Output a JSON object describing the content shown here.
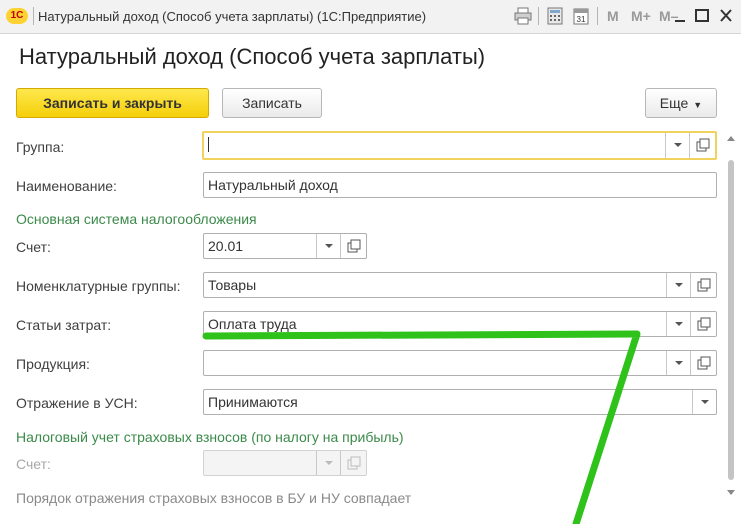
{
  "window": {
    "title": "Натуральный доход (Способ учета зарплаты)  (1С:Предприятие)",
    "logo_text": "1C",
    "toolbar": {
      "m": "M",
      "m_plus": "M+",
      "m_minus": "M–",
      "icons": [
        "print-icon",
        "calculator-icon",
        "calendar-icon",
        "minimize-icon",
        "maximize-icon",
        "close-icon"
      ]
    }
  },
  "form": {
    "title": "Натуральный доход (Способ учета зарплаты)",
    "buttons": {
      "save_close": "Записать и закрыть",
      "save": "Записать",
      "more": "Еще"
    }
  },
  "fields": {
    "group": {
      "label": "Группа:",
      "value": ""
    },
    "name": {
      "label": "Наименование:",
      "value": "Натуральный доход"
    },
    "section_main": "Основная система налогообложения",
    "account": {
      "label": "Счет:",
      "value": "20.01"
    },
    "nomenclature": {
      "label": "Номенклатурные группы:",
      "value": "Товары"
    },
    "cost_items": {
      "label": "Статьи затрат:",
      "value": "Оплата труда"
    },
    "products": {
      "label": "Продукция:",
      "value": ""
    },
    "usn": {
      "label": "Отражение в УСН:",
      "value": "Принимаются"
    },
    "section_tax": "Налоговый учет страховых взносов (по налогу на прибыль)",
    "tax_account": {
      "label": "Счет:",
      "value": ""
    },
    "note": "Порядок отражения страховых взносов в БУ и НУ совпадает"
  },
  "colors": {
    "accent_yellow": "#f5cf0a",
    "section_green": "#3b8a4a",
    "annotation_green": "#2ec21a"
  }
}
